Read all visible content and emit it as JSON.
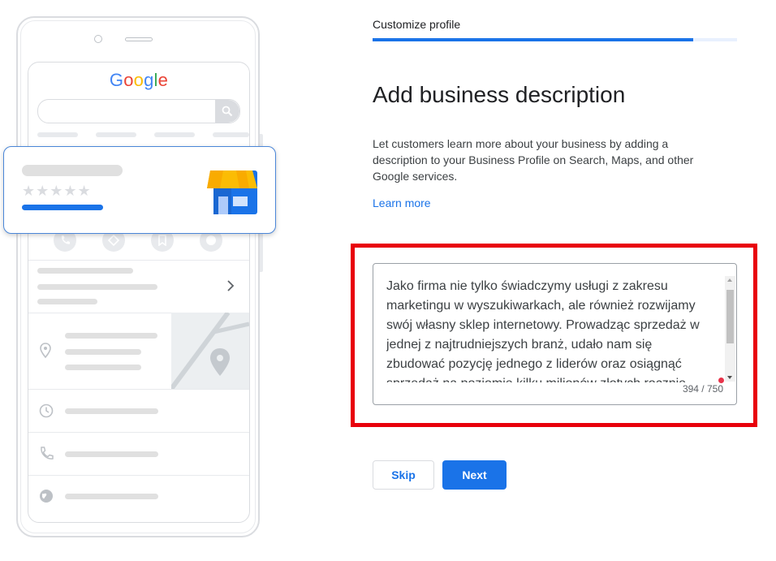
{
  "illustration": {
    "logo_letters": [
      {
        "char": "G",
        "color": "#4285F4"
      },
      {
        "char": "o",
        "color": "#EA4335"
      },
      {
        "char": "o",
        "color": "#FBBC05"
      },
      {
        "char": "g",
        "color": "#4285F4"
      },
      {
        "char": "l",
        "color": "#34A853"
      },
      {
        "char": "e",
        "color": "#EA4335"
      }
    ],
    "stars": "★★★★★",
    "icons": [
      "search-icon",
      "phone-icon",
      "directions-icon",
      "bookmark-icon",
      "globe-icon",
      "chevron-right-icon",
      "location-pin-icon",
      "clock-icon",
      "storefront-icon"
    ]
  },
  "progress": {
    "step_label": "Customize profile",
    "percent": 88
  },
  "main": {
    "title": "Add business description",
    "description": "Let customers learn more about your business by adding a description to your Business Profile on Search, Maps, and other Google services.",
    "learn_more": "Learn more"
  },
  "textarea": {
    "value": "Jako firma nie tylko świadczymy usługi z zakresu marketingu w wyszukiwarkach, ale również rozwijamy swój własny sklep internetowy. Prowadząc sprzedaż w jednej z najtrudniejszych branż, udało nam się zbudować pozycję jednego z liderów oraz osiągnąć sprzedaż na poziomie kilku milionów złotych rocznie.",
    "counter": "394 / 750"
  },
  "buttons": {
    "skip": "Skip",
    "next": "Next"
  },
  "colors": {
    "accent": "#1a73e8",
    "highlight": "#e8000b"
  }
}
